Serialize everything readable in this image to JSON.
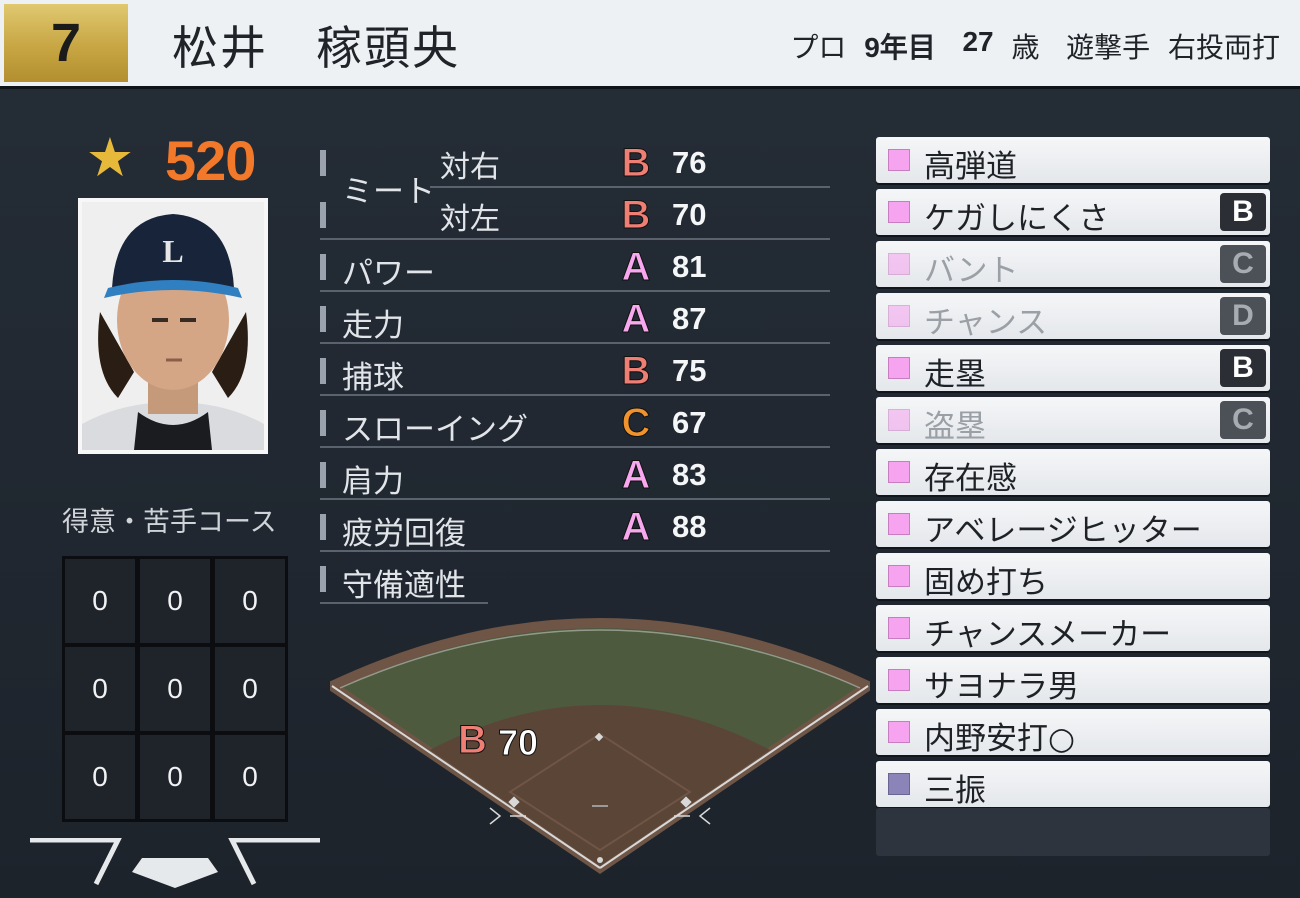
{
  "player": {
    "number": "7",
    "name": "松井　稼頭央",
    "pro_label": "プロ",
    "pro_years": "9年目",
    "age": "27",
    "age_unit": "歳",
    "position": "遊撃手",
    "bats_throws": "右投両打"
  },
  "overall": {
    "value": "520",
    "star_color": "#e7b93a"
  },
  "course": {
    "title": "得意・苦手コース",
    "cells": [
      "0",
      "0",
      "0",
      "0",
      "0",
      "0",
      "0",
      "0",
      "0"
    ]
  },
  "stats": {
    "meet_label": "ミート",
    "meet_right_label": "対右",
    "meet_right_grade": "B",
    "meet_right_value": "76",
    "meet_left_label": "対左",
    "meet_left_grade": "B",
    "meet_left_value": "70",
    "rows": [
      {
        "label": "パワー",
        "grade": "A",
        "value": "81"
      },
      {
        "label": "走力",
        "grade": "A",
        "value": "87"
      },
      {
        "label": "捕球",
        "grade": "B",
        "value": "75"
      },
      {
        "label": "スローイング",
        "grade": "C",
        "value": "67"
      },
      {
        "label": "肩力",
        "grade": "A",
        "value": "83"
      },
      {
        "label": "疲労回復",
        "grade": "A",
        "value": "88"
      }
    ],
    "defense_label": "守備適性",
    "grade_colors": {
      "A": "#f7a8ee",
      "B": "#ef7e75",
      "C": "#f0932c"
    }
  },
  "field": {
    "grade": "B",
    "value": "70"
  },
  "abilities": [
    {
      "label": "高弾道",
      "badge": "",
      "dim": false,
      "color": "pink"
    },
    {
      "label": "ケガしにくさ",
      "badge": "B",
      "dim": false,
      "color": "pink"
    },
    {
      "label": "バント",
      "badge": "C",
      "dim": true,
      "color": "pink"
    },
    {
      "label": "チャンス",
      "badge": "D",
      "dim": true,
      "color": "pink"
    },
    {
      "label": "走塁",
      "badge": "B",
      "dim": false,
      "color": "pink"
    },
    {
      "label": "盗塁",
      "badge": "C",
      "dim": true,
      "color": "pink"
    },
    {
      "label": "存在感",
      "badge": "",
      "dim": false,
      "color": "pink"
    },
    {
      "label": "アベレージヒッター",
      "badge": "",
      "dim": false,
      "color": "pink"
    },
    {
      "label": "固め打ち",
      "badge": "",
      "dim": false,
      "color": "pink"
    },
    {
      "label": "チャンスメーカー",
      "badge": "",
      "dim": false,
      "color": "pink"
    },
    {
      "label": "サヨナラ男",
      "badge": "",
      "dim": false,
      "color": "pink"
    },
    {
      "label": "内野安打○",
      "badge": "",
      "dim": false,
      "color": "pink"
    },
    {
      "label": "三振",
      "badge": "",
      "dim": false,
      "color": "blue"
    }
  ]
}
